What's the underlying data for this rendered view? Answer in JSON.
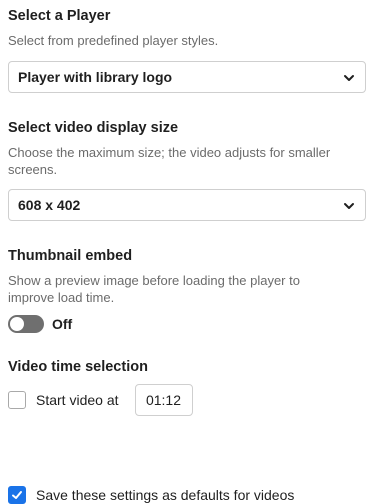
{
  "player": {
    "heading": "Select a Player",
    "description": "Select from predefined player styles.",
    "selected": "Player with library logo"
  },
  "display_size": {
    "heading": "Select video display size",
    "description": "Choose the maximum size; the video adjusts for smaller screens.",
    "selected": "608 x 402"
  },
  "thumbnail": {
    "heading": "Thumbnail embed",
    "description": "Show a preview image before loading the player to improve load time.",
    "toggle_label": "Off"
  },
  "time_selection": {
    "heading": "Video time selection",
    "checkbox_label": "Start video at",
    "time_value": "01:12"
  },
  "defaults": {
    "checkbox_label": "Save these settings as defaults for videos"
  },
  "colors": {
    "accent": "#1a73e8",
    "toggle_off": "#6f6f6f"
  },
  "icons": [
    "chevron-down-icon",
    "checkmark-icon"
  ]
}
